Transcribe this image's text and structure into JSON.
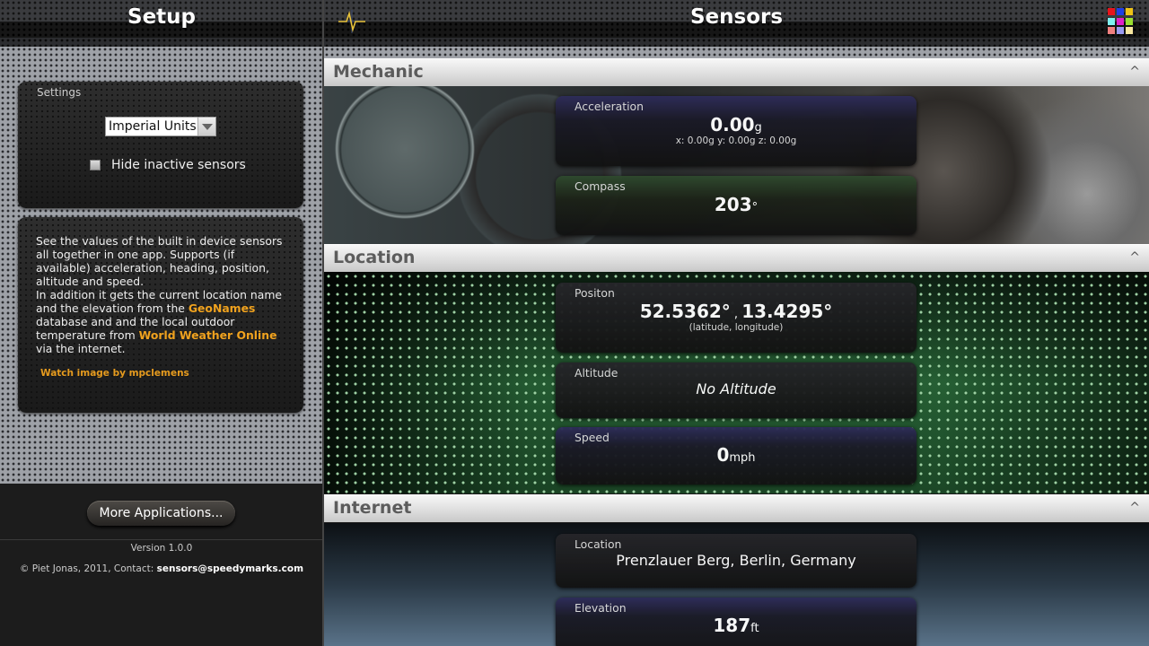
{
  "setup": {
    "title": "Setup",
    "settings": {
      "label": "Settings",
      "units_selected": "Imperial Units",
      "hide_inactive_label": "Hide inactive sensors",
      "hide_inactive_checked": false
    },
    "about": {
      "text_1": "See the values of the built in device sensors all together in one app. Supports (if available) acceleration, heading, position, altitude and speed.",
      "text_2": "In addition it gets the current location name and the elevation from the ",
      "link_geonames": "GeoNames",
      "text_3": " database and and the local outdoor temperature from ",
      "link_weather": "World Weather Online",
      "text_4": " via the internet.",
      "credit": "Watch image by mpclemens"
    },
    "more_apps_label": "More Applications...",
    "version": "Version 1.0.0",
    "copyright": "© Piet Jonas, 2011, Contact: ",
    "contact_email": "sensors@speedymarks.com"
  },
  "sensors": {
    "title": "Sensors",
    "icons": {
      "left": "pulse-icon",
      "right": "apps-grid-icon",
      "grid_colors": [
        "#e8141c",
        "#1f3ee8",
        "#f0c416",
        "#7ff0f0",
        "#e020c8",
        "#9ae030",
        "#f08080",
        "#9a9af0",
        "#f8e8a0"
      ]
    },
    "collapse_glyph": "^",
    "sections": {
      "mechanic": {
        "name": "Mechanic",
        "acceleration": {
          "label": "Acceleration",
          "value": "0.00",
          "unit": "g",
          "detail": "x: 0.00g  y: 0.00g  z: 0.00g"
        },
        "compass": {
          "label": "Compass",
          "value": "203",
          "unit": "°"
        }
      },
      "location": {
        "name": "Location",
        "position": {
          "label": "Positon",
          "latitude": "52.5362°",
          "separator": " , ",
          "longitude": "13.4295°",
          "detail": "(latitude, longitude)"
        },
        "altitude": {
          "label": "Altitude",
          "value": "No Altitude"
        },
        "speed": {
          "label": "Speed",
          "value": "0",
          "unit": "mph"
        }
      },
      "internet": {
        "name": "Internet",
        "location": {
          "label": "Location",
          "value": "Prenzlauer Berg, Berlin, Germany"
        },
        "elevation": {
          "label": "Elevation",
          "value": "187",
          "unit": "ft"
        }
      }
    }
  }
}
